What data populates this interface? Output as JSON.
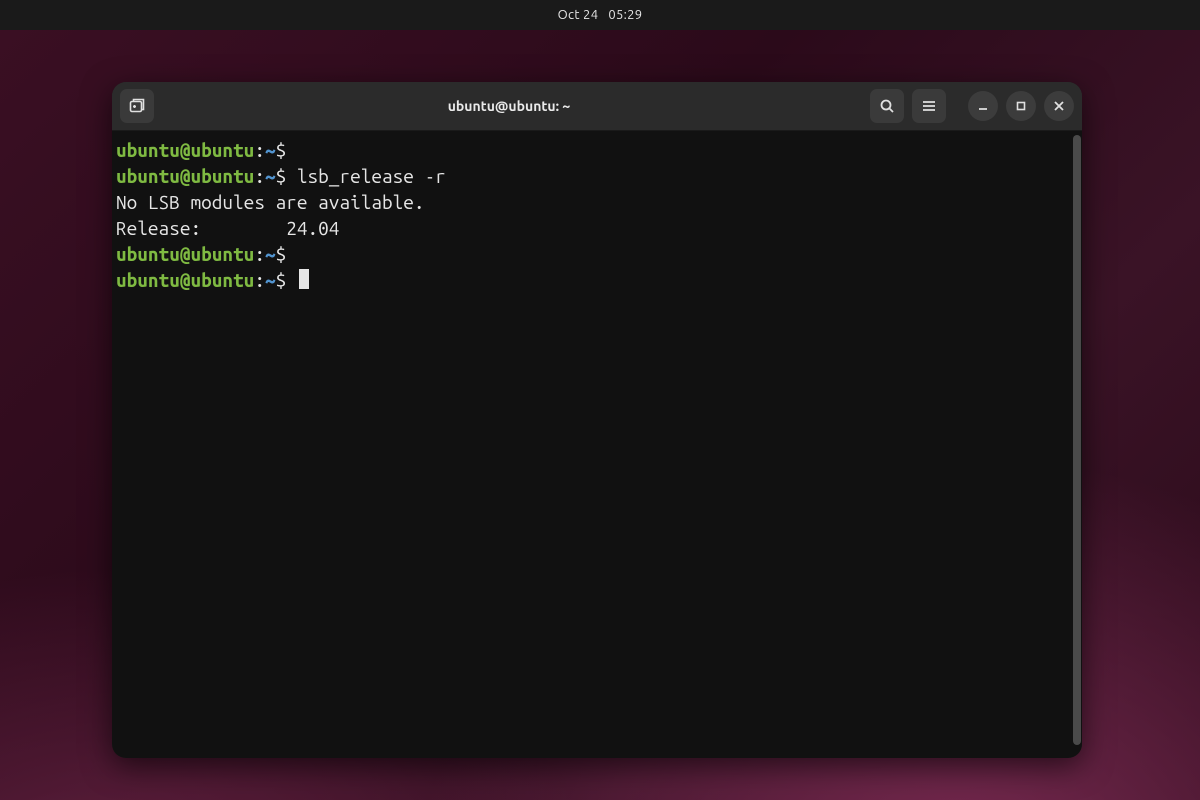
{
  "menubar": {
    "date": "Oct 24",
    "time": "05:29"
  },
  "terminal": {
    "title": "ubuntu@ubuntu: ~",
    "prompt": {
      "user_host": "ubuntu@ubuntu",
      "separator": ":",
      "path": "~",
      "symbol": "$"
    },
    "lines": [
      {
        "type": "prompt",
        "command": ""
      },
      {
        "type": "prompt",
        "command": "lsb_release -r"
      },
      {
        "type": "output",
        "text": "No LSB modules are available."
      },
      {
        "type": "output",
        "text": "Release:        24.04"
      },
      {
        "type": "prompt",
        "command": ""
      },
      {
        "type": "prompt_cursor",
        "command": ""
      }
    ]
  },
  "icons": {
    "new_tab": "new-tab-icon",
    "search": "search-icon",
    "hamburger": "hamburger-icon",
    "minimize": "minimize-icon",
    "maximize": "maximize-icon",
    "close": "close-icon"
  }
}
